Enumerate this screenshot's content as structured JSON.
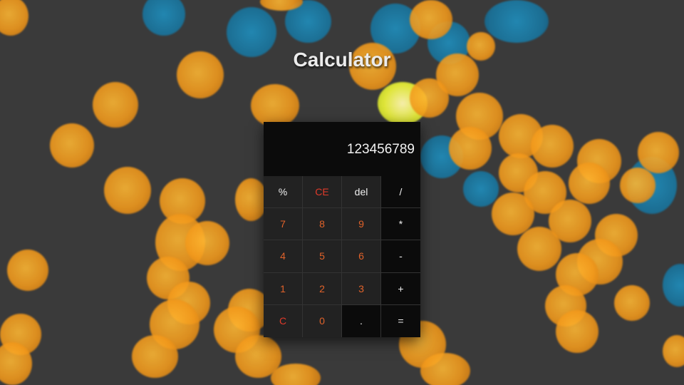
{
  "app": {
    "title": "Calculator"
  },
  "display": {
    "value": "123456789"
  },
  "keys": [
    {
      "label": "%",
      "name": "key-percent"
    },
    {
      "label": "CE",
      "name": "key-clear-entry"
    },
    {
      "label": "del",
      "name": "key-delete"
    },
    {
      "label": "/",
      "name": "key-divide"
    },
    {
      "label": "7",
      "name": "key-7"
    },
    {
      "label": "8",
      "name": "key-8"
    },
    {
      "label": "9",
      "name": "key-9"
    },
    {
      "label": "*",
      "name": "key-multiply"
    },
    {
      "label": "4",
      "name": "key-4"
    },
    {
      "label": "5",
      "name": "key-5"
    },
    {
      "label": "6",
      "name": "key-6"
    },
    {
      "label": "-",
      "name": "key-subtract"
    },
    {
      "label": "1",
      "name": "key-1"
    },
    {
      "label": "2",
      "name": "key-2"
    },
    {
      "label": "3",
      "name": "key-3"
    },
    {
      "label": "+",
      "name": "key-add"
    },
    {
      "label": "C",
      "name": "key-clear"
    },
    {
      "label": "0",
      "name": "key-0"
    },
    {
      "label": ".",
      "name": "key-decimal"
    },
    {
      "label": "=",
      "name": "key-equals"
    }
  ],
  "colors": {
    "background": "#3a3a3a",
    "calculator": "#0b0b0b",
    "display_text": "#f2f2f2",
    "clear_keys": "#e03a2a",
    "digit_keys": "#e0622a",
    "operator_keys": "#f0f0f0"
  }
}
